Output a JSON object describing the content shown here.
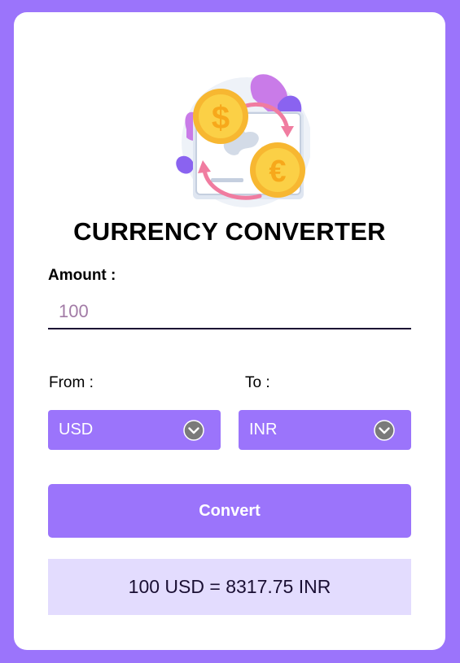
{
  "header": {
    "title": "CURRENCY CONVERTER"
  },
  "illustration": {
    "icon": "currency-exchange-illustration",
    "coin_from_symbol": "$",
    "coin_to_symbol": "€"
  },
  "form": {
    "amount_label": "Amount :",
    "amount_value": "100",
    "from_label": "From :",
    "to_label": "To :",
    "from_currency": "USD",
    "to_currency": "INR",
    "convert_label": "Convert"
  },
  "result": {
    "text": "100 USD = 8317.75 INR"
  },
  "colors": {
    "accent": "#9b74fb",
    "result_bg": "#e3dcfe",
    "card_bg": "#ffffff"
  }
}
